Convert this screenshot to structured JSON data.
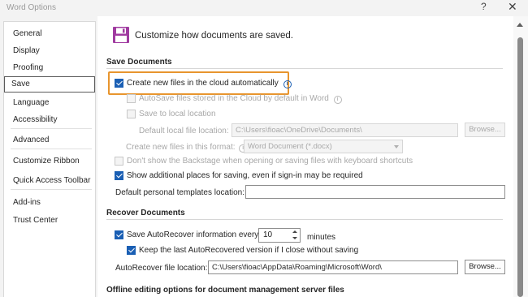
{
  "window": {
    "title": "Word Options",
    "help_glyph": "?",
    "close_glyph": "✕"
  },
  "sidebar": {
    "items": [
      {
        "label": "General"
      },
      {
        "label": "Display"
      },
      {
        "label": "Proofing"
      },
      {
        "label": "Save",
        "active": true
      },
      {
        "label": "Language"
      },
      {
        "label": "Accessibility"
      },
      {
        "label": "Advanced"
      },
      {
        "label": "Customize Ribbon"
      },
      {
        "label": "Quick Access Toolbar"
      },
      {
        "label": "Add-ins"
      },
      {
        "label": "Trust Center"
      }
    ]
  },
  "main": {
    "header": "Customize how documents are saved.",
    "save_documents": {
      "heading": "Save Documents",
      "create_cloud_label": "Create new files in the cloud automatically",
      "create_cloud_checked": true,
      "autosave_label": "AutoSave files stored in the Cloud by default in Word",
      "save_local_label": "Save to local location",
      "default_local_label": "Default local file location:",
      "default_local_value": "C:\\Users\\fioac\\OneDrive\\Documents\\",
      "browse_label": "Browse...",
      "format_label": "Create new files in this format:",
      "format_value": "Word Document (*.docx)",
      "backstage_label": "Don't show the Backstage when opening or saving files with keyboard shortcuts",
      "additional_places_label": "Show additional places for saving, even if sign-in may be required",
      "additional_places_checked": true,
      "templates_label": "Default personal templates location:",
      "templates_value": ""
    },
    "recover_documents": {
      "heading": "Recover Documents",
      "autorecover_label": "Save AutoRecover information every",
      "autorecover_checked": true,
      "autorecover_minutes": "10",
      "minutes_label": "minutes",
      "keep_last_label": "Keep the last AutoRecovered version if I close without saving",
      "keep_last_checked": true,
      "file_location_label": "AutoRecover file location:",
      "file_location_value": "C:\\Users\\fioac\\AppData\\Roaming\\Microsoft\\Word\\",
      "browse_label": "Browse..."
    },
    "offline": {
      "heading": "Offline editing options for document management server files"
    }
  },
  "colors": {
    "accent": "#1a5fb4",
    "highlight": "#e8952e",
    "save_icon": "#a03ba0"
  }
}
